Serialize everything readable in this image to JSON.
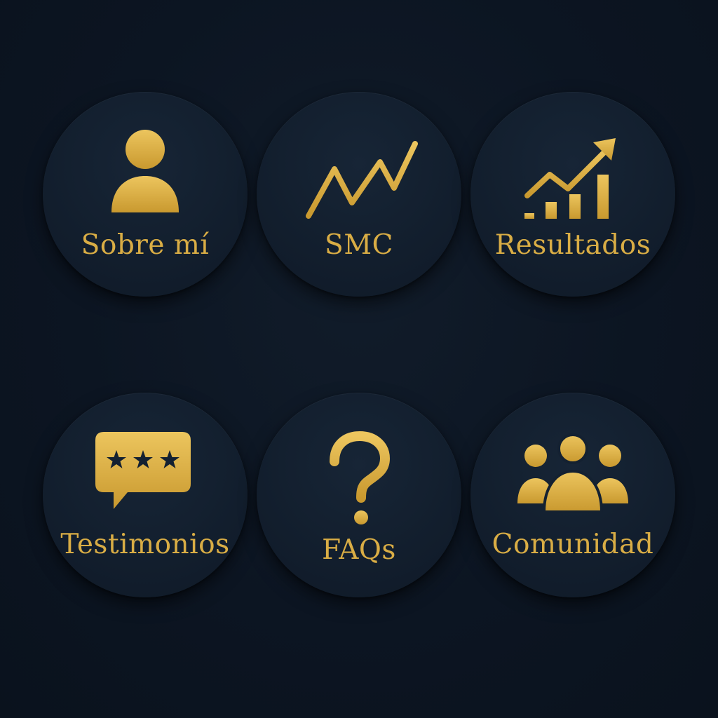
{
  "theme": {
    "background": "#0c1522",
    "button": "#142131",
    "gold": "#d9ad45",
    "gold_light": "#e8c15a",
    "gold_dark": "#b98c2c"
  },
  "menu": {
    "items": [
      {
        "label": "Sobre mí",
        "icon": "person-icon"
      },
      {
        "label": "SMC",
        "icon": "zigzag-line-icon"
      },
      {
        "label": "Resultados",
        "icon": "growth-chart-icon"
      },
      {
        "label": "Testimonios",
        "icon": "rating-chat-bubble-icon"
      },
      {
        "label": "FAQs",
        "icon": "question-mark-icon"
      },
      {
        "label": "Comunidad",
        "icon": "group-icon"
      }
    ]
  }
}
